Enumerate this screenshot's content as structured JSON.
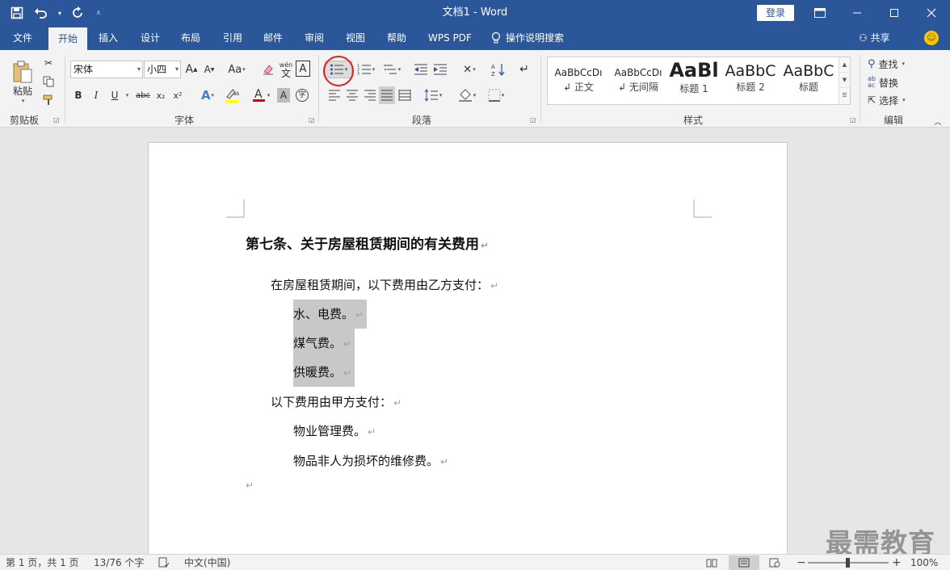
{
  "window": {
    "title": "文档1  -  Word",
    "login_label": "登录",
    "qat": {
      "save_icon": "save-icon",
      "undo_icon": "undo-icon",
      "redo_icon": "redo-icon",
      "customize_icon": "customize-qat-icon"
    }
  },
  "tabs": [
    "文件",
    "开始",
    "插入",
    "设计",
    "布局",
    "引用",
    "邮件",
    "审阅",
    "视图",
    "帮助",
    "WPS PDF",
    "操作说明搜索"
  ],
  "active_tab": "开始",
  "share_label": "共享",
  "ribbon": {
    "clipboard": {
      "label": "剪贴板",
      "paste_label": "粘贴"
    },
    "font": {
      "label": "字体",
      "font_name": "宋体",
      "font_size": "小四",
      "grow_label": "A",
      "shrink_label": "A",
      "case_label": "Aa",
      "bold": "B",
      "italic": "I",
      "underline": "U",
      "strike": "abc",
      "subscript": "x₂",
      "superscript": "x²",
      "phonetic_label": "wén",
      "border_char_label": "A",
      "enclose_label": "字"
    },
    "paragraph": {
      "label": "段落"
    },
    "styles": {
      "label": "样式",
      "items": [
        {
          "sample": "AaBbCcDı",
          "name": "↲ 正文"
        },
        {
          "sample": "AaBbCcDı",
          "name": "↲ 无间隔"
        },
        {
          "sample": "AaBl",
          "name": "标题 1"
        },
        {
          "sample": "AaBbC",
          "name": "标题 2"
        },
        {
          "sample": "AaBbC",
          "name": "标题"
        }
      ]
    },
    "editing": {
      "label": "编辑",
      "find": "查找",
      "replace": "替换",
      "select": "选择"
    }
  },
  "document": {
    "heading": "第七条、关于房屋租赁期间的有关费用",
    "lines": [
      {
        "text": "在房屋租赁期间，以下费用由乙方支付：",
        "indent": "level1",
        "selected": false
      },
      {
        "text": "水、电费。",
        "indent": "level2",
        "selected": true
      },
      {
        "text": "煤气费。",
        "indent": "level2",
        "selected": true
      },
      {
        "text": "供暖费。",
        "indent": "level2",
        "selected": true
      },
      {
        "text": "以下费用由甲方支付：",
        "indent": "level1",
        "selected": false
      },
      {
        "text": "物业管理费。",
        "indent": "level2",
        "selected": false
      },
      {
        "text": "物品非人为损坏的维修费。",
        "indent": "level2",
        "selected": false
      }
    ],
    "paragraph_mark": "↵"
  },
  "watermark": "最需教育",
  "status": {
    "page": "第 1 页，共 1 页",
    "words": "13/76 个字",
    "language": "中文(中国)",
    "zoom": "100%",
    "zoom_minus": "−",
    "zoom_plus": "+",
    "zoom_level": 1.0
  },
  "colors": {
    "accent": "#2b579a",
    "highlight_circle": "#e02020"
  }
}
